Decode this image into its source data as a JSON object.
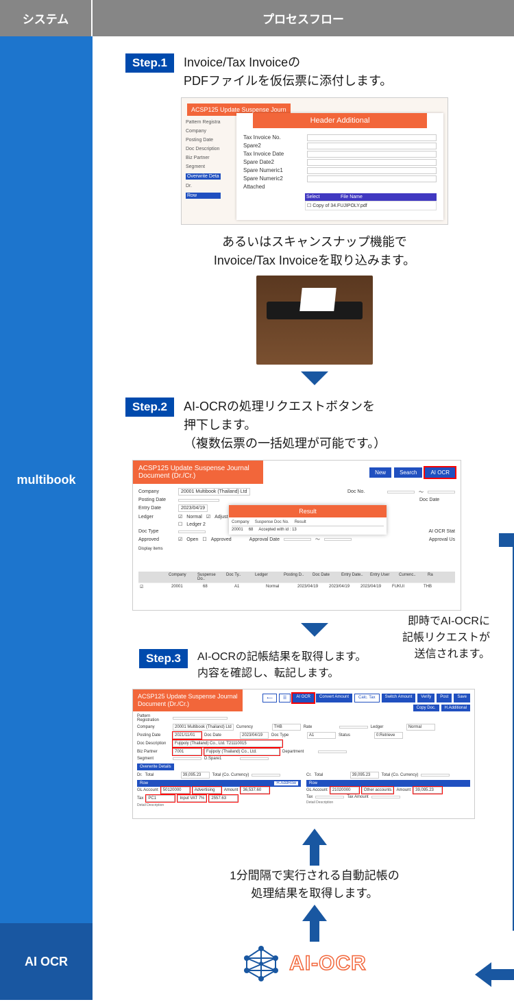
{
  "header": {
    "left": "システム",
    "right": "プロセスフロー"
  },
  "sidebar": {
    "multibook": "multibook",
    "aiocr": "AI OCR"
  },
  "steps": {
    "s1": {
      "badge": "Step.1",
      "text": "Invoice/Tax Invoiceの\nPDFファイルを仮伝票に添付します。"
    },
    "s2": {
      "badge": "Step.2",
      "text": "AI-OCRの処理リクエストボタンを\n押下します。\n（複数伝票の一括処理が可能です。）"
    },
    "s3": {
      "badge": "Step.3",
      "text": "AI-OCRの記帳結果を取得します。\n内容を確認し、転記します。"
    }
  },
  "mid_text": "あるいはスキャンスナップ機能で\nInvoice/Tax Invoiceを取り込みます。",
  "note_right": "即時でAI-OCRに\n記帳リクエストが\n送信されます。",
  "bottom_text": "1分間隔で実行される自動記帳の\n処理結果を取得します。",
  "ocr_label": "AI-OCR",
  "shot1": {
    "title": "ACSP125 Update Suspense Journ",
    "header_additional": "Header Additional",
    "left_labels": [
      "Pattern Registra",
      "Company",
      "Posting Date",
      "Doc Description",
      "Biz Partner",
      "Segment",
      "Overwrite Deta",
      "Dr.",
      "Row"
    ],
    "fields": [
      "Tax Invoice No.",
      "Spare2",
      "Tax Invoice Date",
      "Spare Date2",
      "Spare Numeric1",
      "Spare Numeric2",
      "Attached"
    ],
    "file_header": {
      "select": "Select",
      "filename": "File Name"
    },
    "file": "Copy of 34.FUJIPOLY.pdf"
  },
  "shot2": {
    "title": "ACSP125 Update Suspense Journal Document (Dr./Cr.)",
    "buttons": {
      "new": "New",
      "search": "Search",
      "aiocr": "AI OCR"
    },
    "fields": {
      "company_k": "Company",
      "company_v": "20001 Multibook (Thailand) Ltd",
      "docno_k": "Doc No.",
      "posting_k": "Posting Date",
      "docdate_k": "Doc Date",
      "entry_k": "Entry Date",
      "entry_v": "2023/04/19",
      "ledger_k": "Ledger",
      "ledger_v1": "Normal",
      "ledger_v2": "Adjust",
      "ledger_v3": "Ledger 2",
      "doctype_k": "Doc Type",
      "aiocrstat_k": "AI OCR Stat",
      "approved_k": "Approved",
      "approved_v1": "Open",
      "approved_v2": "Approved",
      "approvaldate_k": "Approval Date",
      "approvalus_k": "Approval Us"
    },
    "result": {
      "title": "Result",
      "th": [
        "Company",
        "Suspense Doc No.",
        "Result"
      ],
      "td": [
        "20001",
        "68",
        "Accepted with id : 13"
      ]
    },
    "display_items": "Display items",
    "grid_h": [
      "",
      "Company",
      "Suspense Do..",
      "Doc Ty..",
      "Ledger",
      "Posting D..",
      "Doc Date",
      "Entry Date..",
      "Entry User",
      "Currenc..",
      "Ra"
    ],
    "grid_r": [
      "",
      "20001",
      "68",
      "A1",
      "Normal",
      "2023/04/19",
      "2023/04/19",
      "2023/04/19",
      "FUKUI",
      "THB",
      ""
    ]
  },
  "shot3": {
    "title": "ACSP125 Update Suspense Journal Document (Dr./Cr.)",
    "toolbar": [
      "AI OCR",
      "Convert Amount",
      "Calc. Tax",
      "Switch Amount",
      "Verify",
      "Post",
      "Save",
      "Copy Doc.",
      "H.Additional"
    ],
    "pattern_k": "Pattern Registration",
    "row1": {
      "company_k": "Company",
      "company_v": "20001 Multibook (Thailand) Ltd",
      "currency_k": "Currency",
      "currency_v": "THB",
      "rate_k": "Rate",
      "ledger_k": "Ledger",
      "ledger_v": "Normal"
    },
    "row2": {
      "posting_k": "Posting Date",
      "posting_v": "2021/11/01",
      "docdate_k": "Doc Date",
      "docdate_v": "2023/04/19",
      "doctype_k": "Doc Type",
      "doctype_v": "A1",
      "status_k": "Status",
      "status_v": "0:Retrieve"
    },
    "row3": {
      "docdesc_k": "Doc Description",
      "docdesc_v": "Fujipoly (Thailand) Co., Ltd. T21110015"
    },
    "row4": {
      "bp_k": "Biz Partner",
      "bp_v1": "7001",
      "bp_v2": "Fujipoly (Thailand) Co., Ltd.",
      "dept_k": "Department"
    },
    "row5": {
      "seg_k": "Segment",
      "dspare_k": "D.Spare1"
    },
    "overwrite": "Overwrite Details",
    "dr": "Dr.",
    "cr": "Cr.",
    "total_k": "Total",
    "total_v": "39,095.23",
    "totalco_k": "Total (Co. Currency)",
    "row_label": "Row",
    "addrow": "H.AddRow",
    "dr_line1": {
      "gl_k": "GL Account",
      "gl_v": "50120000",
      "gl_n": "Advertising",
      "amt_k": "Amount",
      "amt_v": "36,537.60"
    },
    "dr_line2": {
      "tax_k": "Tax",
      "tax_v": "PC1",
      "tax_n": "Input VAT 7%",
      "tamt_v": "2557.63"
    },
    "cr_line1": {
      "gl_k": "GL Account",
      "gl_v": "21020000",
      "gl_n": "Other accounts",
      "amt_k": "Amount",
      "amt_v": "39,095.23"
    },
    "cr_line2": {
      "tax_k": "Tax",
      "tamt_k": "Tax Amount"
    },
    "detaildesc": "Detail Description"
  }
}
